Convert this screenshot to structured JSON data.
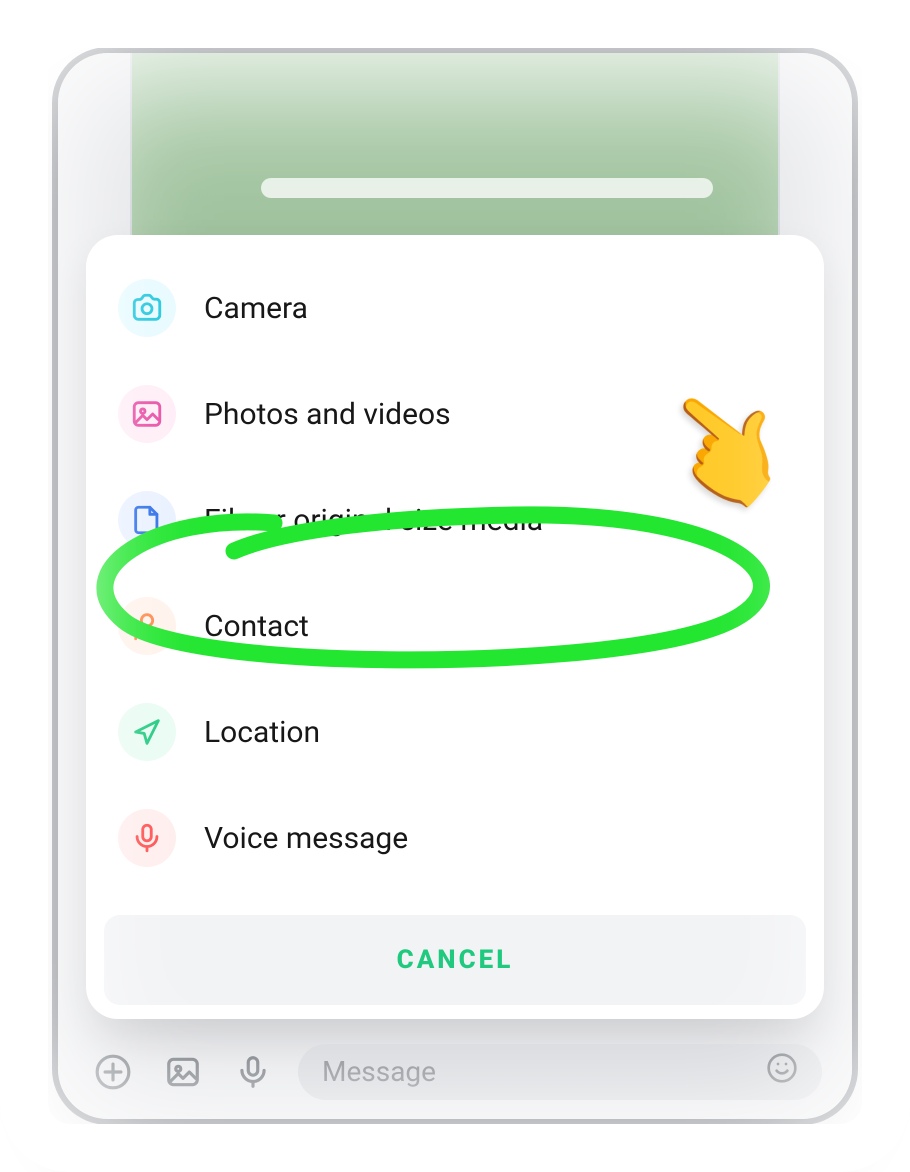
{
  "sheet": {
    "items": [
      {
        "label": "Camera"
      },
      {
        "label": "Photos and videos"
      },
      {
        "label": "File or original size media"
      },
      {
        "label": "Contact"
      },
      {
        "label": "Location"
      },
      {
        "label": "Voice message"
      }
    ],
    "cancel_label": "CANCEL"
  },
  "composer": {
    "placeholder": "Message"
  },
  "annotation": {
    "highlighted_item_index": 2,
    "pointer_emoji": "👉"
  }
}
